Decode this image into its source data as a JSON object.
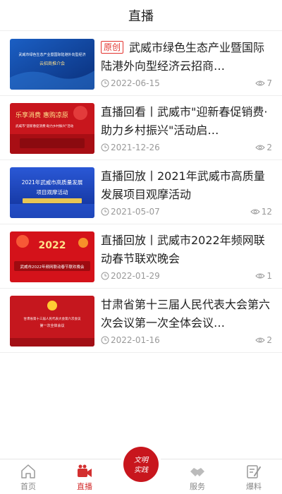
{
  "header": {
    "title": "直播"
  },
  "items": [
    {
      "badge": "原创",
      "title": "武威市绿色生态产业暨国际陆港外向型经济云招商…",
      "date": "2022-06-15",
      "views": "7",
      "thumb_text": [
        "武威市绿色生态产业暨国际陆港外向型经济",
        "云招商推介会"
      ]
    },
    {
      "title": "直播回看丨武威市\"迎新春促销费·助力乡村振兴\"活动启…",
      "date": "2021-12-26",
      "views": "2",
      "thumb_text": [
        "乐享消费 惠购凉原",
        "武威市\"迎新春促消费·助力乡村振兴\"活动"
      ]
    },
    {
      "title": "直播回放丨2021年武威市高质量发展项目观摩活动",
      "date": "2021-05-07",
      "views": "12",
      "thumb_text": [
        "2021年武威市高质量发展",
        "项目观摩活动"
      ]
    },
    {
      "title": "直播回放丨武威市2022年频网联动春节联欢晚会",
      "date": "2022-01-29",
      "views": "1",
      "thumb_text": [
        "2022",
        "武威市2022年频网联动春节联欢晚会"
      ]
    },
    {
      "title": "甘肃省第十三届人民代表大会第六次会议第一次全体会议…",
      "date": "2022-01-16",
      "views": "2",
      "thumb_text": [
        "甘肃省第十三届人民代表大会第六次会议",
        "第一次全体会议"
      ]
    }
  ],
  "tabbar": {
    "home": "首页",
    "live": "直播",
    "center": [
      "文明",
      "实践"
    ],
    "service": "服务",
    "report": "爆料"
  },
  "colors": {
    "accent": "#d32f2f",
    "muted": "#999999"
  }
}
